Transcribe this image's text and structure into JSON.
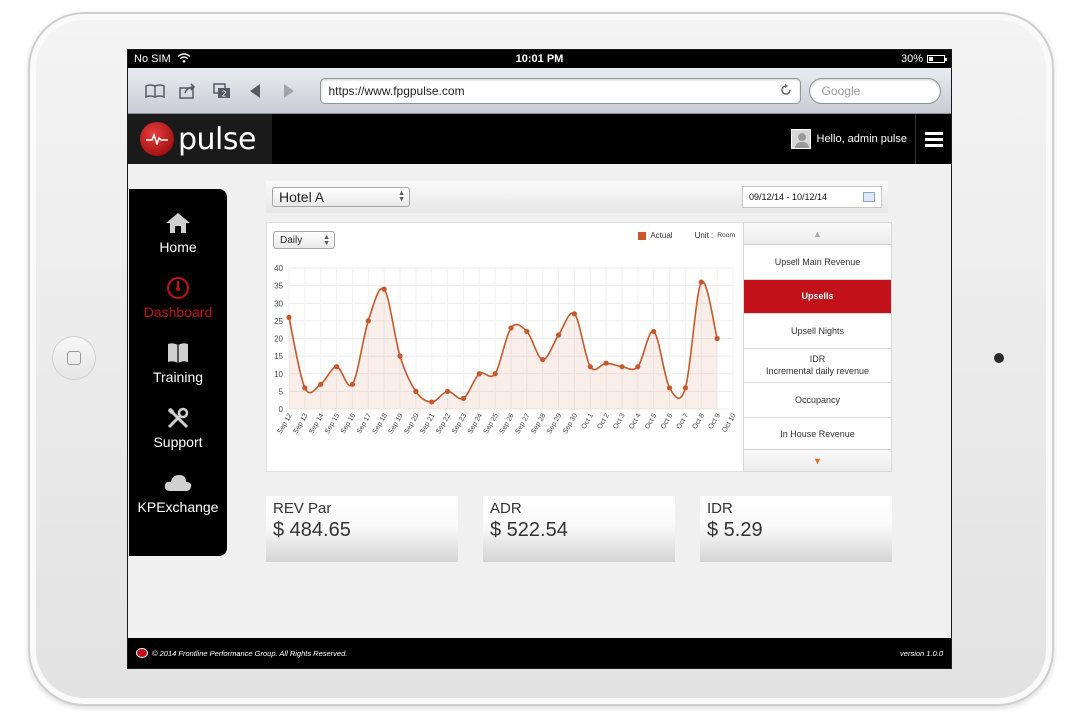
{
  "status_bar": {
    "carrier": "No SIM",
    "time": "10:01 PM",
    "battery": "30%"
  },
  "browser": {
    "url": "https://www.fpgpulse.com",
    "search_placeholder": "Google"
  },
  "header": {
    "logo_text": "pulse",
    "greeting": "Hello, admin pulse"
  },
  "sidebar": {
    "items": [
      {
        "label": "Home",
        "icon": "home-icon",
        "active": false
      },
      {
        "label": "Dashboard",
        "icon": "gauge-icon",
        "active": true
      },
      {
        "label": "Training",
        "icon": "book-icon",
        "active": false
      },
      {
        "label": "Support",
        "icon": "tools-icon",
        "active": false
      },
      {
        "label": "KPExchange",
        "icon": "cloud-icon",
        "active": false
      }
    ]
  },
  "filters": {
    "hotel": "Hotel A",
    "date_range": "09/12/14 - 10/12/14",
    "period": "Daily"
  },
  "legend": {
    "series": "Actual",
    "unit_label": "Unit :",
    "unit_value": "Room"
  },
  "metrics_menu": {
    "items": [
      {
        "label": "Upsell Main Revenue",
        "sub": "",
        "active": false
      },
      {
        "label": "Upsells",
        "sub": "",
        "active": true
      },
      {
        "label": "Upsell Nights",
        "sub": "",
        "active": false
      },
      {
        "label": "IDR",
        "sub": "Incremental daily revenue",
        "active": false
      },
      {
        "label": "Occupancy",
        "sub": "",
        "active": false
      },
      {
        "label": "In House Revenue",
        "sub": "",
        "active": false
      }
    ]
  },
  "kpis": [
    {
      "label": "REV Par",
      "value": "$ 484.65"
    },
    {
      "label": "ADR",
      "value": "$ 522.54"
    },
    {
      "label": "IDR",
      "value": "$ 5.29"
    }
  ],
  "footer": {
    "copyright": "© 2014 Frontline Performance Group. All Rights Reserved.",
    "version": "version 1.0.0"
  },
  "colors": {
    "accent_red": "#c3111a",
    "series_line": "#c8582a"
  },
  "chart_data": {
    "type": "area",
    "categories": [
      "Sep 12",
      "Sep 13",
      "Sep 14",
      "Sep 15",
      "Sep 16",
      "Sep 17",
      "Sep 18",
      "Sep 19",
      "Sep 20",
      "Sep 21",
      "Sep 22",
      "Sep 23",
      "Sep 24",
      "Sep 25",
      "Sep 26",
      "Sep 27",
      "Sep 28",
      "Sep 29",
      "Sep 30",
      "Oct 1",
      "Oct 2",
      "Oct 3",
      "Oct 4",
      "Oct 5",
      "Oct 6",
      "Oct 7",
      "Oct 8",
      "Oct 9",
      "Oct 10"
    ],
    "series": [
      {
        "name": "Actual",
        "values": [
          26,
          6,
          7,
          12,
          7,
          25,
          34,
          15,
          5,
          2,
          5,
          3,
          10,
          10,
          23,
          22,
          14,
          21,
          27,
          12,
          13,
          12,
          12,
          22,
          6,
          6,
          36,
          20
        ]
      }
    ],
    "yticks": [
      0,
      5,
      10,
      15,
      20,
      25,
      30,
      35,
      40
    ],
    "ylim": [
      0,
      40
    ],
    "grid": true
  }
}
